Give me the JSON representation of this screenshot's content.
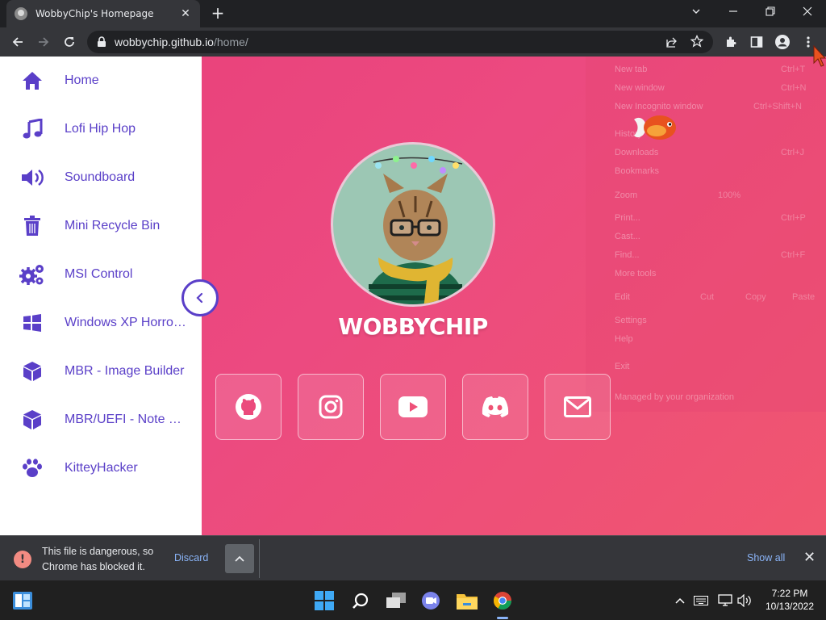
{
  "browser": {
    "tab_title": "WobbyChip's Homepage",
    "url_host": "wobbychip.github.io",
    "url_path": "/home/"
  },
  "sidebar": {
    "items": [
      {
        "label": "Home",
        "icon": "home-icon"
      },
      {
        "label": "Lofi Hip Hop",
        "icon": "music-icon"
      },
      {
        "label": "Soundboard",
        "icon": "speaker-icon"
      },
      {
        "label": "Mini Recycle Bin",
        "icon": "trash-icon"
      },
      {
        "label": "MSI Control",
        "icon": "gears-icon"
      },
      {
        "label": "Windows XP Horror Edition",
        "icon": "windows-icon"
      },
      {
        "label": "MBR - Image Builder",
        "icon": "cube-icon"
      },
      {
        "label": "MBR/UEFI - Note Builder",
        "icon": "cube-icon"
      },
      {
        "label": "KitteyHacker",
        "icon": "paw-icon"
      }
    ]
  },
  "profile": {
    "name": "WOBBYCHIP"
  },
  "social": [
    "github-icon",
    "instagram-icon",
    "youtube-icon",
    "discord-icon",
    "mail-icon"
  ],
  "chrome_menu": {
    "items": [
      "New tab",
      "New window",
      "New Incognito window",
      "History",
      "Downloads",
      "Bookmarks",
      "Zoom",
      "Print...",
      "Cast...",
      "Find...",
      "More tools",
      "Edit",
      "Settings",
      "Help",
      "Exit",
      "Managed by your organization"
    ],
    "shortcuts": [
      "Ctrl+T",
      "Ctrl+N",
      "Ctrl+Shift+N",
      "Ctrl+J",
      "Ctrl+P",
      "Ctrl+F"
    ],
    "zoom": "100%",
    "edit_actions": [
      "Cut",
      "Copy",
      "Paste"
    ]
  },
  "download": {
    "message": "This file is dangerous, so Chrome has blocked it.",
    "discard": "Discard",
    "show_all": "Show all"
  },
  "taskbar": {
    "time": "7:22 PM",
    "date": "10/13/2022"
  },
  "colors": {
    "accent": "#5a3fc8",
    "page_bg": "#e8407a",
    "chrome_dark": "#202124",
    "chrome_mid": "#35363a"
  }
}
